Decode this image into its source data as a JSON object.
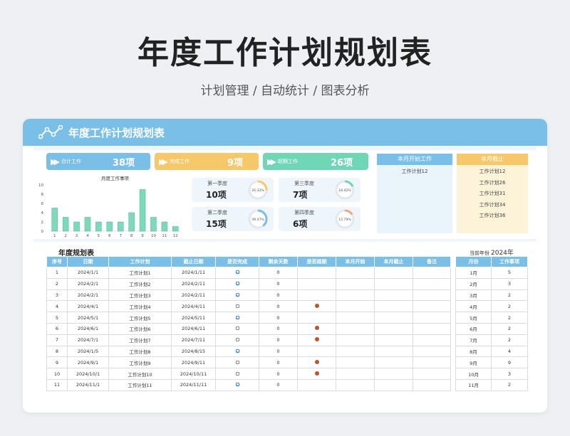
{
  "page": {
    "title": "年度工作计划规划表",
    "subtitle": "计划管理 / 自动统计 / 图表分析"
  },
  "card": {
    "header_title": "年度工作计划规划表"
  },
  "stats": [
    {
      "label": "合计工作",
      "value": "38项",
      "color": "#79bfe8"
    },
    {
      "label": "完成工作",
      "value": "9项",
      "color": "#f7c86a"
    },
    {
      "label": "超期工作",
      "value": "26项",
      "color": "#6fd6b6"
    }
  ],
  "chart_data": {
    "type": "bar",
    "title": "月度工作事项",
    "categories": [
      "1",
      "2",
      "3",
      "4",
      "5",
      "6",
      "7",
      "8",
      "9",
      "10",
      "11",
      "12"
    ],
    "values": [
      5,
      3,
      2,
      3,
      2,
      2,
      2,
      4,
      9,
      3,
      2,
      1
    ],
    "ylim": [
      0,
      10
    ],
    "yticks": [
      "0",
      "2",
      "4",
      "6",
      "8",
      "10"
    ],
    "color": "#7dd9b8"
  },
  "quarters": [
    {
      "name": "第一季度",
      "value": "10项",
      "percent": "26.32%",
      "fraction": 0.2632,
      "color": "#f7c86a"
    },
    {
      "name": "第三季度",
      "value": "7项",
      "percent": "18.42%",
      "fraction": 0.1842,
      "color": "#6fd6b6"
    },
    {
      "name": "第二季度",
      "value": "15项",
      "percent": "39.47%",
      "fraction": 0.3947,
      "color": "#79bfe8"
    },
    {
      "name": "第四季度",
      "value": "6项",
      "percent": "15.79%",
      "fraction": 0.1579,
      "color": "#f2a983"
    }
  ],
  "month_start": {
    "title": "本月开始工作",
    "items": [
      "工作计划12"
    ],
    "color": "#79bfe8"
  },
  "month_end": {
    "title": "本月截止",
    "items": [
      "工作计划12",
      "工作计划26",
      "工作计划31",
      "工作计划34",
      "工作计划36"
    ],
    "color": "#f7c86a"
  },
  "table": {
    "title": "年度规划表",
    "current_year_label": "当前年份",
    "current_year": "2024年",
    "headers": [
      "序号",
      "日期",
      "工作计划",
      "截止日期",
      "是否完成",
      "剩余天数",
      "是否超期",
      "本月开始",
      "本月截止",
      "备注"
    ],
    "rows": [
      [
        "1",
        "2024/1/1",
        "工作计划1",
        "2024/1/11",
        true,
        "0",
        false
      ],
      [
        "2",
        "2024/2/1",
        "工作计划2",
        "2024/2/11",
        true,
        "0",
        false
      ],
      [
        "3",
        "2024/2/1",
        "工作计划3",
        "2024/2/11",
        true,
        "0",
        false
      ],
      [
        "4",
        "2024/4/1",
        "工作计划4",
        "2024/4/11",
        false,
        "0",
        true
      ],
      [
        "5",
        "2024/5/1",
        "工作计划5",
        "2024/5/11",
        true,
        "0",
        false
      ],
      [
        "6",
        "2024/6/1",
        "工作计划6",
        "2024/6/11",
        false,
        "0",
        true
      ],
      [
        "7",
        "2024/7/1",
        "工作计划7",
        "2024/7/11",
        false,
        "0",
        true
      ],
      [
        "8",
        "2024/1/5",
        "工作计划8",
        "2024/8/15",
        true,
        "0",
        false
      ],
      [
        "9",
        "2024/9/1",
        "工作计划9",
        "2024/9/11",
        false,
        "0",
        true
      ],
      [
        "10",
        "2024/10/1",
        "工作计划10",
        "2024/10/11",
        false,
        "0",
        true
      ],
      [
        "11",
        "2024/11/1",
        "工作计划11",
        "2024/11/11",
        true,
        "0",
        false
      ]
    ]
  },
  "summary": {
    "headers": [
      "月份",
      "工作事项"
    ],
    "rows": [
      [
        "1月",
        "5"
      ],
      [
        "2月",
        "3"
      ],
      [
        "3月",
        "2"
      ],
      [
        "4月",
        "2"
      ],
      [
        "5月",
        "2"
      ],
      [
        "6月",
        "2"
      ],
      [
        "7月",
        "2"
      ],
      [
        "8月",
        "4"
      ],
      [
        "9月",
        "9"
      ],
      [
        "10月",
        "3"
      ],
      [
        "11月",
        "2"
      ]
    ]
  }
}
